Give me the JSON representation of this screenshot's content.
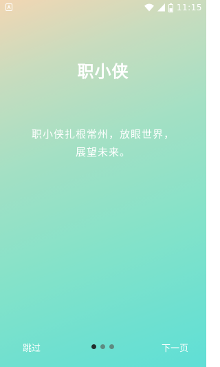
{
  "status_bar": {
    "time": "11:15",
    "icons": [
      "notification-a-icon",
      "wifi-icon",
      "signal-icon",
      "battery-icon"
    ]
  },
  "page": {
    "title": "职小侠",
    "description_line1": "职小侠扎根常州，放眼世界，",
    "description_line2": "展望未来。"
  },
  "navigation": {
    "skip_label": "跳过",
    "next_label": "下一页",
    "pages_total": 3,
    "current_page": 1
  },
  "colors": {
    "gradient_start": "#f2d6b3",
    "gradient_end": "#5fdfd6",
    "text": "#ffffff",
    "dot_active": "#222c2a",
    "dot_inactive": "#5e8a80"
  }
}
